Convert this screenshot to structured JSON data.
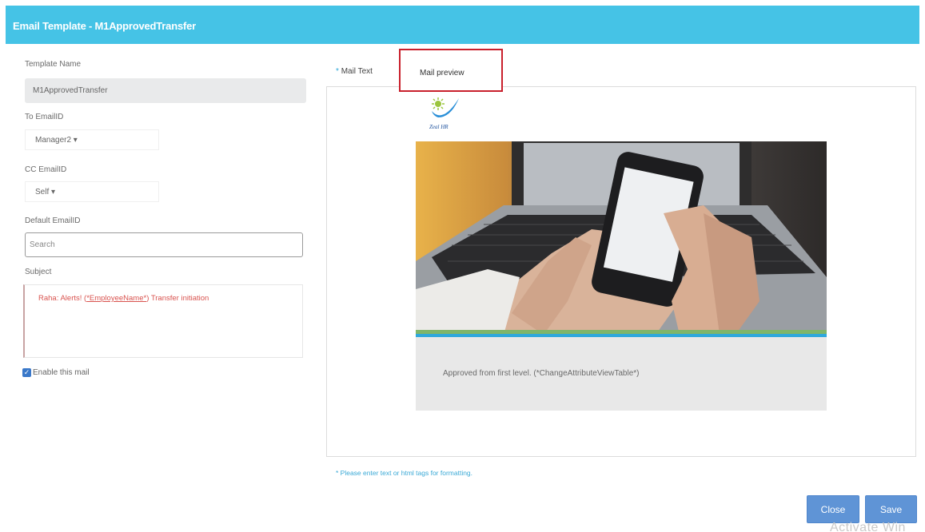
{
  "header": {
    "title": "Email Template - M1ApprovedTransfer"
  },
  "form": {
    "template_name_label": "Template Name",
    "template_name_value": "M1ApprovedTransfer",
    "to_label": "To EmailID",
    "to_value": "Manager2 ▾",
    "cc_label": "CC EmailID",
    "cc_value": "Self ▾",
    "default_label": "Default EmailID",
    "default_placeholder": "Search",
    "subject_label": "Subject",
    "subject_prefix": "Raha: Alerts! (",
    "subject_token": "*EmployeeName*",
    "subject_suffix": ") Transfer initiation",
    "enable_label": "Enable this mail",
    "enable_checked": true
  },
  "tabs": {
    "mail_text_star": "*",
    "mail_text": "Mail Text",
    "mail_preview": "Mail preview"
  },
  "preview": {
    "logo_text": "Zeal HR",
    "body_text": "Approved from first level. (*ChangeAttributeViewTable*)"
  },
  "note": "* Please enter text or html tags for formatting.",
  "buttons": {
    "close": "Close",
    "save": "Save"
  },
  "watermark": "Activate Win",
  "colors": {
    "header": "#45c3e6",
    "button": "#5f94d6",
    "highlight": "#c9202c",
    "subject_text": "#d9534f"
  },
  "icons": {
    "checkbox": "checkmark-icon",
    "logo": "zeal-logo-icon"
  }
}
